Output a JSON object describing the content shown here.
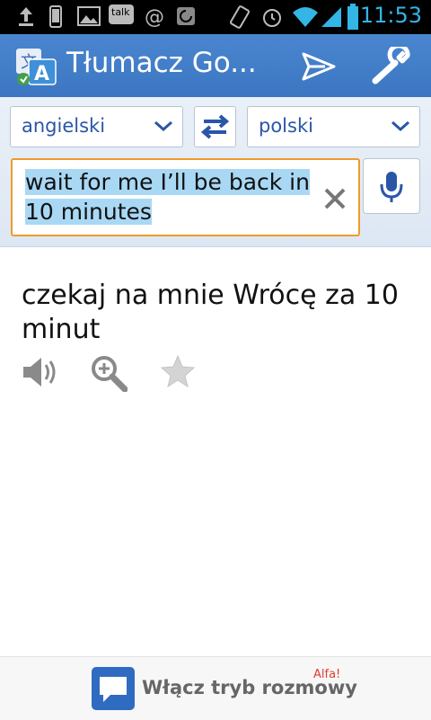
{
  "status_bar": {
    "time": "11:53",
    "icons": [
      "upload-icon",
      "phone-icon",
      "picture-icon",
      "talk-icon",
      "at-icon",
      "sync-icon",
      "rotate-icon",
      "alarm-icon",
      "wifi-icon",
      "signal-icon",
      "battery-icon"
    ],
    "talk_label": "talk",
    "accent_color": "#33b5e5"
  },
  "action_bar": {
    "title": "Tłumacz Go...",
    "logo_icon": "translate-logo-icon",
    "send_icon": "send-icon",
    "settings_icon": "wrench-icon",
    "background_color": "#4380cb"
  },
  "languages": {
    "source": "angielski",
    "target": "polski",
    "swap_icon": "swap-arrows-icon"
  },
  "input": {
    "value": "wait for me I’ll be back in 10 minutes",
    "border_color": "#f09a2a",
    "highlight_color": "#a9d8f5",
    "clear_icon": "close-icon",
    "mic_icon": "microphone-icon"
  },
  "result": {
    "text": "czekaj na mnie Wrócę za 10 minut",
    "actions": [
      "speaker-icon",
      "zoom-icon",
      "star-icon"
    ]
  },
  "bottom": {
    "conversation_label": "Włącz tryb rozmowy",
    "alpha_badge": "Alfa!",
    "conversation_icon": "chat-bubble-icon"
  }
}
